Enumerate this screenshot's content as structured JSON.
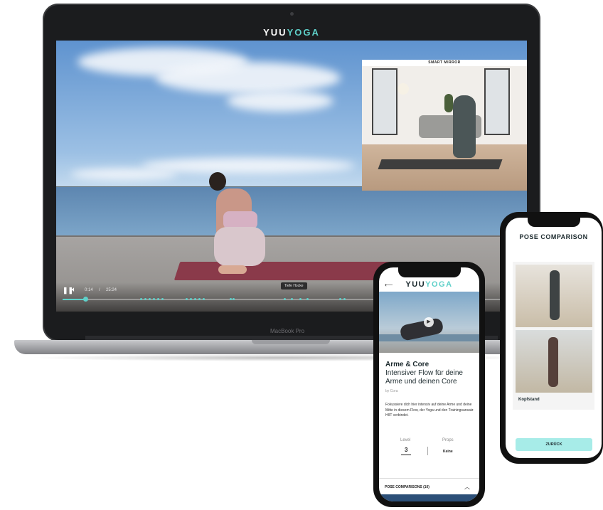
{
  "laptop": {
    "brand_a": "YUU",
    "brand_b": "YOGA",
    "mirror_label": "SMART MIRROR",
    "player": {
      "play_icon": "pause-icon",
      "volume_icon": "volume-icon",
      "time_current": "0:14",
      "time_sep": "/",
      "time_total": "25:24",
      "progress": 0.05,
      "tooltip": "Tiefe Hocke"
    },
    "model_label": "MacBook Pro"
  },
  "phone_front": {
    "back_icon": "arrow-left-icon",
    "logo_a": "YUU",
    "logo_b": "YOGA",
    "play_icon": "play-icon",
    "title": "Arme & Core",
    "subtitle": "Intensiver Flow für deine Arme und deinen Core",
    "author": "by Cora",
    "description": "Fokussiere dich hier intensiv auf deine Arme und deine Mitte in diesem Flow, der Yoga und den Trainingsansatz HIIT verbindet.",
    "level_label": "Level",
    "level_value": "3",
    "props_label": "Props",
    "props_value": "Keine",
    "pose_comparisons_label": "POSE COMPARISONS (10)",
    "chevron_icon": "chevron-up-icon"
  },
  "phone_back": {
    "title_a": "POSE",
    "title_b": "COMPARISON",
    "caption": "Kopfstand",
    "back_button": "ZURÜCK"
  },
  "colors": {
    "accent": "#5fd0c9",
    "button_bg": "#a7ece8",
    "mat": "#8a3a4a"
  }
}
